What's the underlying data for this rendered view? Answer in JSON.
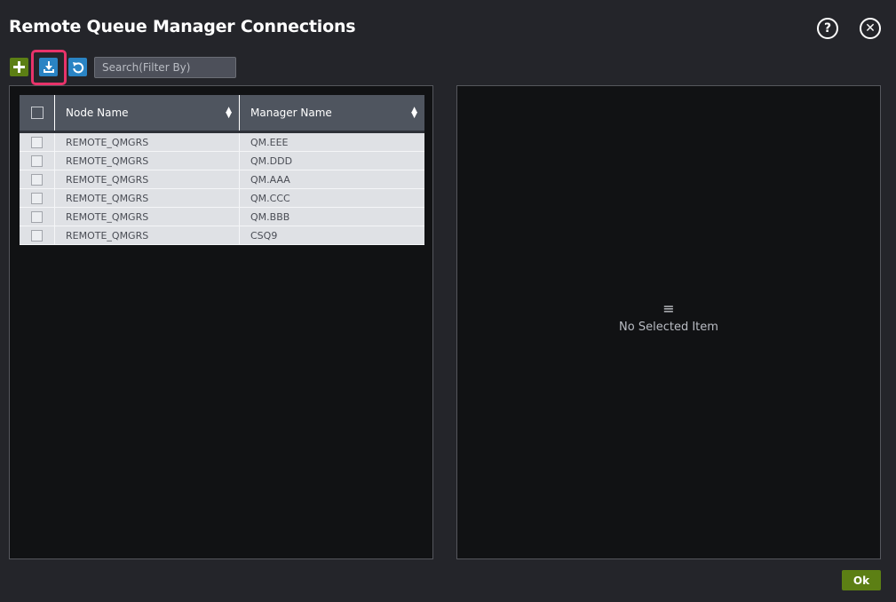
{
  "dialog": {
    "title": "Remote Queue Manager Connections",
    "help_icon_glyph": "?",
    "close_icon_glyph": "✕"
  },
  "toolbar": {
    "add_icon": "plus-icon",
    "download_icon": "download-icon",
    "refresh_icon": "refresh-icon",
    "search_placeholder": "Search(Filter By)",
    "search_value": ""
  },
  "grid": {
    "columns": [
      "Node Name",
      "Manager Name"
    ],
    "rows": [
      {
        "node": "REMOTE_QMGRS",
        "manager": "QM.EEE",
        "checked": false
      },
      {
        "node": "REMOTE_QMGRS",
        "manager": "QM.DDD",
        "checked": false
      },
      {
        "node": "REMOTE_QMGRS",
        "manager": "QM.AAA",
        "checked": false
      },
      {
        "node": "REMOTE_QMGRS",
        "manager": "QM.CCC",
        "checked": false
      },
      {
        "node": "REMOTE_QMGRS",
        "manager": "QM.BBB",
        "checked": false
      },
      {
        "node": "REMOTE_QMGRS",
        "manager": "CSQ9",
        "checked": false
      }
    ]
  },
  "detail": {
    "empty_icon": "list-icon",
    "empty_text": "No Selected Item"
  },
  "footer": {
    "ok_label": "Ok"
  },
  "colors": {
    "background": "#24252a",
    "panel": "#111214",
    "accent_green": "#5c7f14",
    "accent_blue": "#2a84c4",
    "highlight": "#e8336a",
    "grid_header": "#4f555f",
    "grid_row": "#dfe1e5"
  }
}
